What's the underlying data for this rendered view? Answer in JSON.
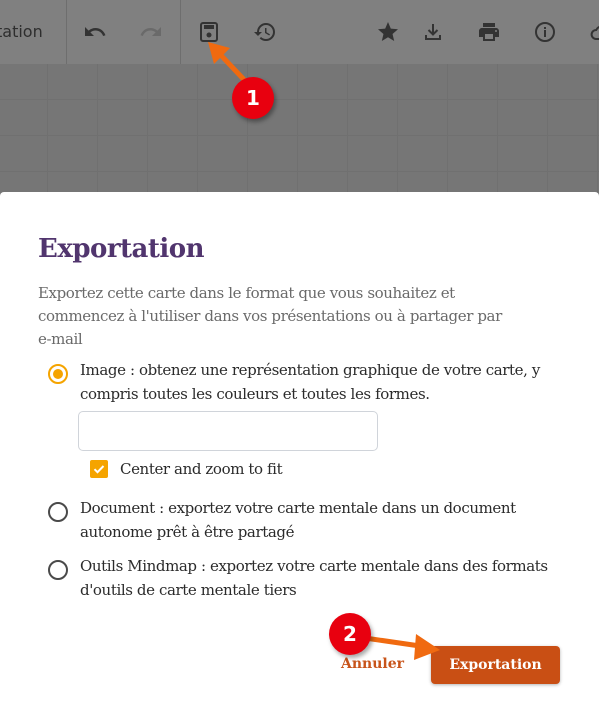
{
  "toolbar": {
    "title": "tation",
    "buttons": [
      {
        "name": "undo",
        "icon": "undo-icon"
      },
      {
        "name": "redo",
        "icon": "redo-icon"
      },
      {
        "name": "save",
        "icon": "save-icon"
      },
      {
        "name": "history",
        "icon": "history-icon"
      },
      {
        "name": "star",
        "icon": "star-icon"
      },
      {
        "name": "download",
        "icon": "download-icon"
      },
      {
        "name": "print",
        "icon": "print-icon"
      },
      {
        "name": "info",
        "icon": "info-icon"
      },
      {
        "name": "cloud",
        "icon": "cloud-icon"
      }
    ]
  },
  "dialog": {
    "title": "Exportation",
    "description": "Exportez cette carte dans le format que vous souhaitez et commencez à l'utiliser dans vos présentations ou à partager par e-mail",
    "options": [
      {
        "label": "Image : obtenez une représentation graphique de votre carte, y compris toutes les couleurs et toutes les formes.",
        "checked": true
      },
      {
        "label": "Document : exportez votre carte mentale dans un document autonome prêt à être partagé",
        "checked": false
      },
      {
        "label": "Outils Mindmap : exportez votre carte mentale dans des formats d'outils de carte mentale tiers",
        "checked": false
      }
    ],
    "format_input": {
      "value": "",
      "placeholder": ""
    },
    "center_zoom": {
      "label": "Center and zoom to fit",
      "checked": true
    },
    "cancel_label": "Annuler",
    "export_label": "Exportation"
  },
  "annotations": {
    "step1": "1",
    "step2": "2"
  },
  "colors": {
    "accent": "#f5a400",
    "title": "#51356e",
    "primary_button": "#c94f14",
    "badge": "#e8000f",
    "arrow": "#f06a10"
  }
}
